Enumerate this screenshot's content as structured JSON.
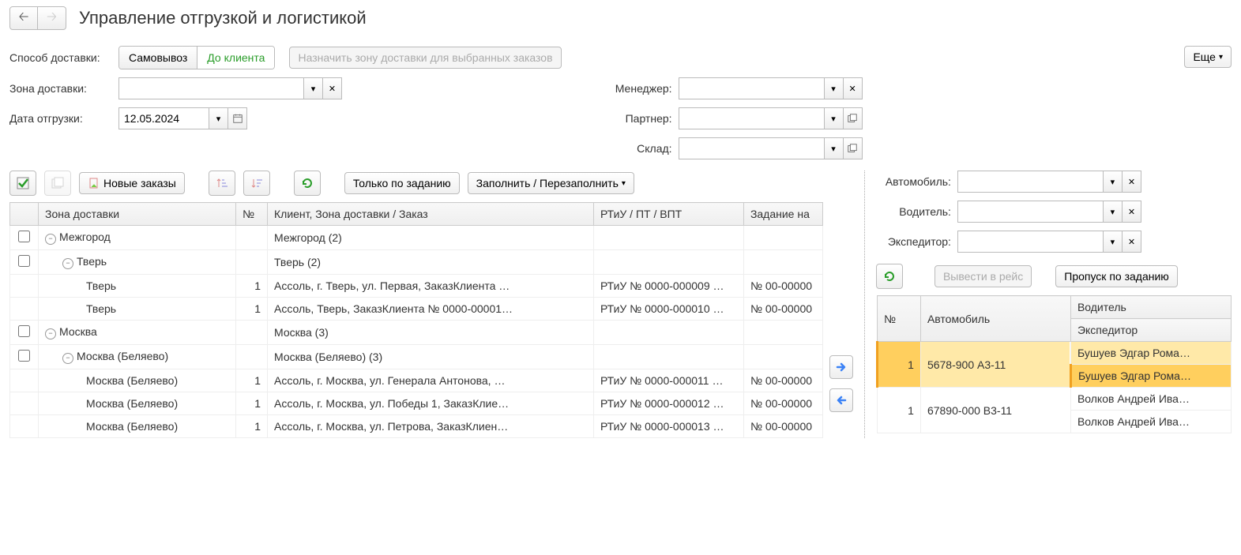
{
  "header": {
    "title": "Управление отгрузкой и логистикой",
    "more": "Еще"
  },
  "filters": {
    "delivery_method_label": "Способ доставки:",
    "pickup": "Самовывоз",
    "to_client": "До клиента",
    "assign_zone_btn": "Назначить зону доставки для выбранных заказов",
    "zone_label": "Зона доставки:",
    "ship_date_label": "Дата отгрузки:",
    "ship_date_value": "12.05.2024",
    "manager_label": "Менеджер:",
    "partner_label": "Партнер:",
    "warehouse_label": "Склад:",
    "vehicle_label": "Автомобиль:",
    "driver_label": "Водитель:",
    "forwarder_label": "Экспедитор:"
  },
  "toolbar": {
    "new_orders": "Новые заказы",
    "only_by_task": "Только по заданию",
    "fill_refill": "Заполнить / Перезаполнить",
    "release": "Вывести в рейс",
    "pass_by_task": "Пропуск по заданию"
  },
  "left_table": {
    "cols": {
      "check": "",
      "zone": "Зона доставки",
      "num": "№",
      "client": "Клиент, Зона доставки / Заказ",
      "rtiu": "РТиУ / ПТ / ВПТ",
      "task": "Задание на"
    },
    "rows": [
      {
        "type": "group",
        "level": 0,
        "check": true,
        "zone": "Межгород",
        "client": "Межгород (2)"
      },
      {
        "type": "group",
        "level": 1,
        "check": true,
        "zone": "Тверь",
        "client": "Тверь (2)"
      },
      {
        "type": "item",
        "level": 2,
        "zone": "Тверь",
        "num": "1",
        "client": "Ассоль, г. Тверь, ул. Первая, ЗаказКлиента …",
        "rtiu": "РТиУ № 0000-000009 …",
        "task": "№ 00-00000"
      },
      {
        "type": "item",
        "level": 2,
        "zone": "Тверь",
        "num": "1",
        "client": "Ассоль, Тверь, ЗаказКлиента № 0000-00001…",
        "rtiu": "РТиУ № 0000-000010 …",
        "task": "№ 00-00000"
      },
      {
        "type": "group",
        "level": 0,
        "check": true,
        "zone": "Москва",
        "client": "Москва (3)"
      },
      {
        "type": "group",
        "level": 1,
        "check": true,
        "zone": "Москва (Беляево)",
        "client": "Москва (Беляево) (3)"
      },
      {
        "type": "item",
        "level": 2,
        "zone": "Москва (Беляево)",
        "num": "1",
        "client": "Ассоль, г. Москва, ул. Генерала Антонова, …",
        "rtiu": "РТиУ № 0000-000011 …",
        "task": "№ 00-00000"
      },
      {
        "type": "item",
        "level": 2,
        "zone": "Москва (Беляево)",
        "num": "1",
        "client": "Ассоль, г. Москва, ул. Победы 1, ЗаказКлие…",
        "rtiu": "РТиУ № 0000-000012 …",
        "task": "№ 00-00000"
      },
      {
        "type": "item",
        "level": 2,
        "zone": "Москва (Беляево)",
        "num": "1",
        "client": "Ассоль, г. Москва, ул. Петрова, ЗаказКлиен…",
        "rtiu": "РТиУ № 0000-000013 …",
        "task": "№ 00-00000"
      }
    ]
  },
  "right_table": {
    "cols": {
      "num": "№",
      "vehicle": "Автомобиль",
      "driver": "Водитель",
      "forwarder": "Экспедитор"
    },
    "rows": [
      {
        "num": "1",
        "vehicle": "5678-900 А3-11",
        "driver": "Бушуев Эдгар Рома…",
        "forwarder": "Бушуев Эдгар Рома…",
        "selected": true
      },
      {
        "num": "1",
        "vehicle": "67890-000 В3-11",
        "driver": "Волков Андрей Ива…",
        "forwarder": "Волков Андрей Ива…"
      }
    ]
  }
}
